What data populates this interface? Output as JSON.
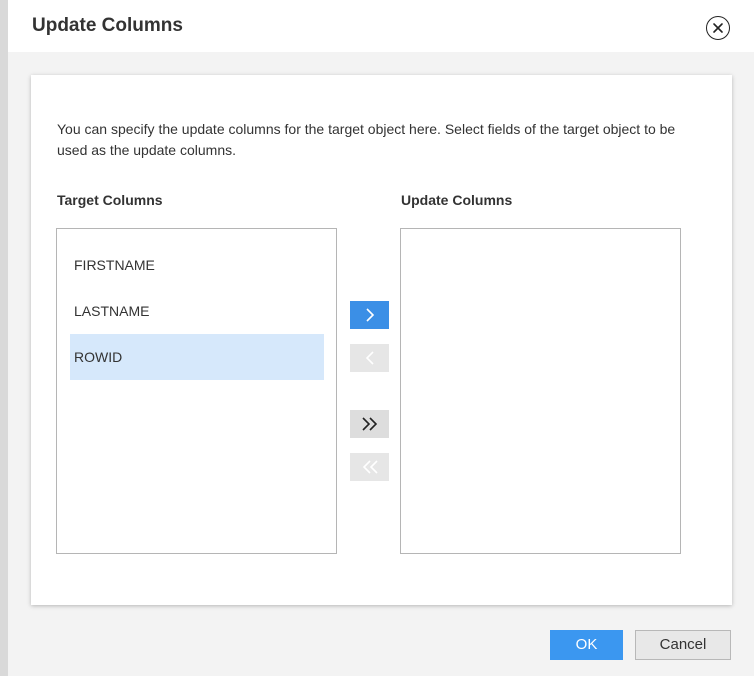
{
  "dialog": {
    "title": "Update Columns",
    "description": "You can specify the update columns for the target object here. Select fields of the target object to be used as the update columns."
  },
  "target_columns": {
    "heading": "Target Columns",
    "items": [
      "FIRSTNAME",
      "LASTNAME",
      "ROWID"
    ],
    "selected": "ROWID"
  },
  "update_columns": {
    "heading": "Update Columns",
    "items": []
  },
  "buttons": {
    "ok_label": "OK",
    "cancel_label": "Cancel"
  },
  "icons": {
    "close": "close-circle-icon",
    "move_right": "chevron-right-icon",
    "move_left": "chevron-left-icon",
    "move_all_right": "double-chevron-right-icon",
    "move_all_left": "double-chevron-left-icon"
  },
  "colors": {
    "accent": "#3b97f0",
    "selection": "#d6e8fb"
  }
}
